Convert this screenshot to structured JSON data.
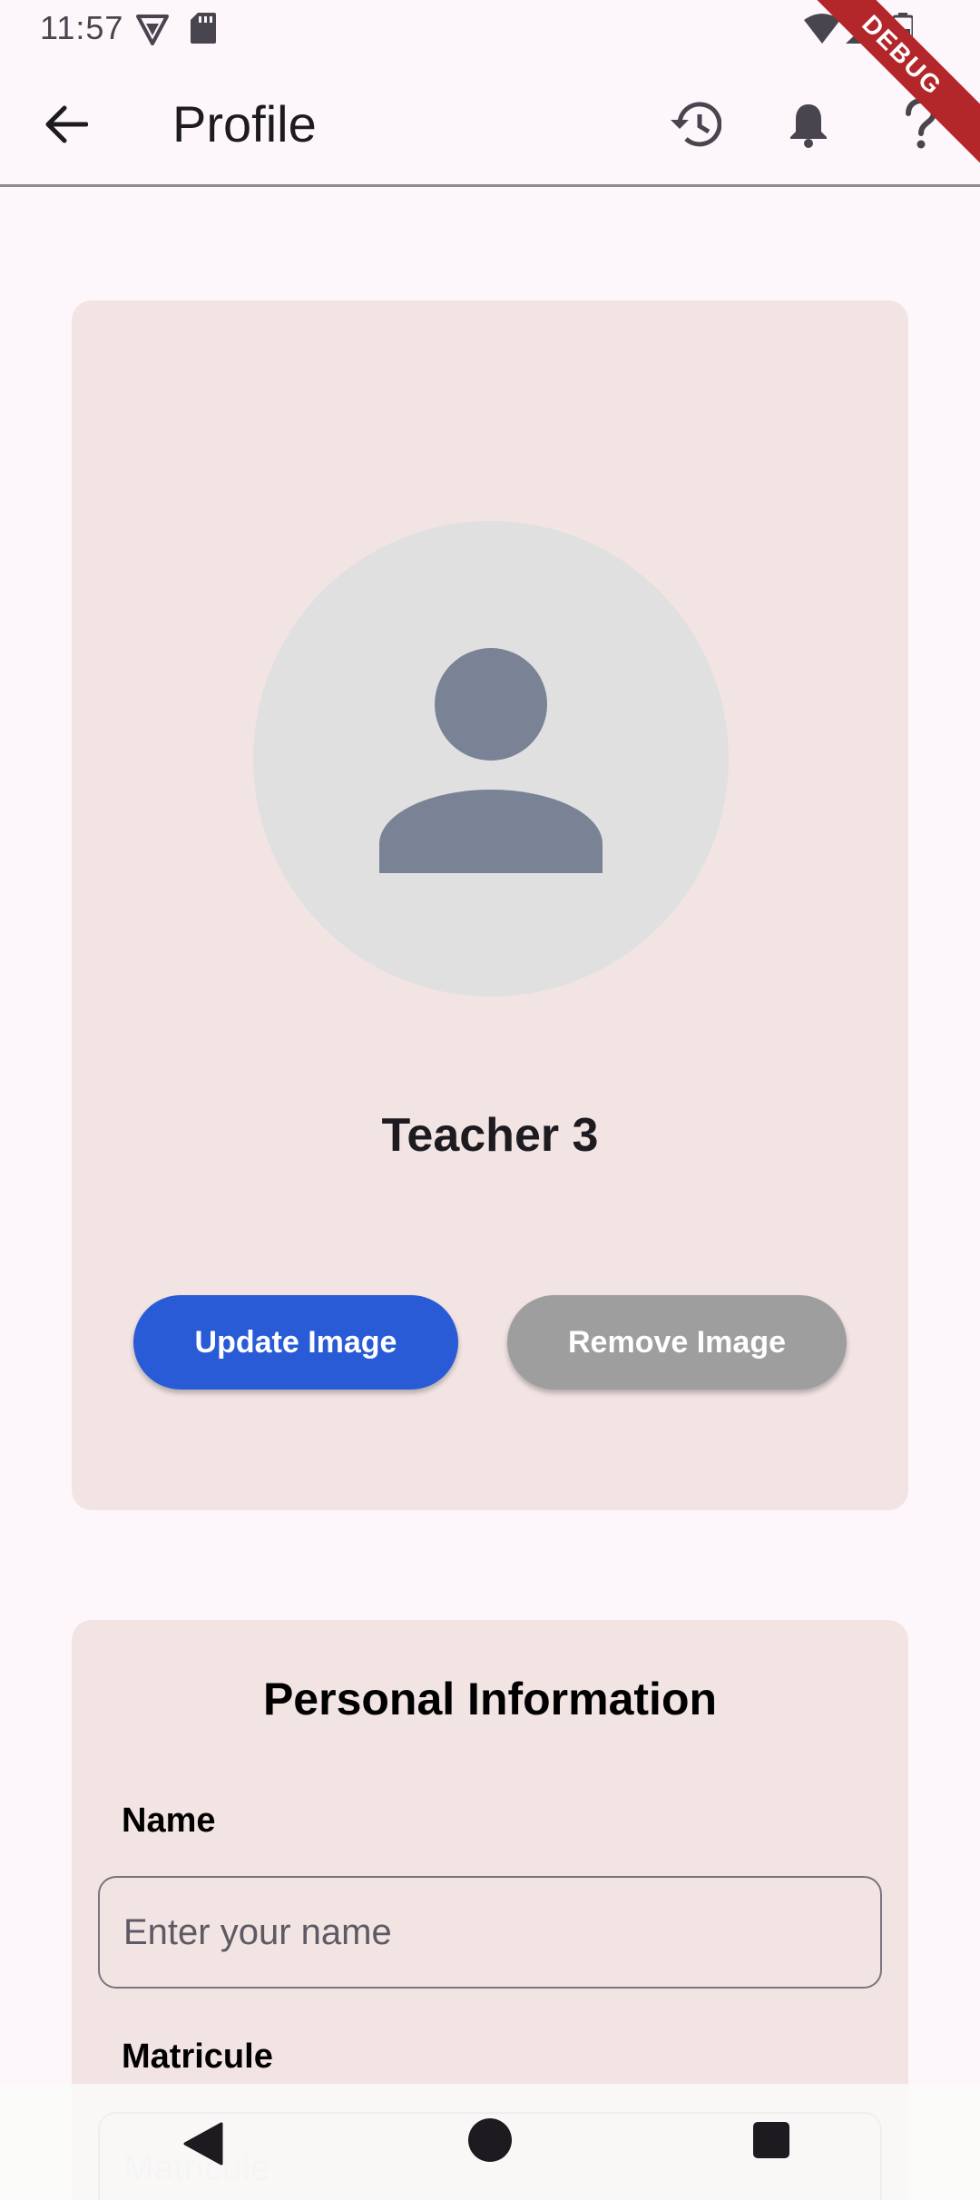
{
  "status_bar": {
    "time": "11:57",
    "icons": [
      "vpn-shield-icon",
      "sd-card-icon",
      "wifi-icon",
      "signal-icon",
      "battery-icon"
    ],
    "debug_banner": "DEBUG"
  },
  "app_bar": {
    "title": "Profile",
    "icons": [
      "arrow-back-icon",
      "history-icon",
      "bell-icon",
      "help-icon"
    ]
  },
  "profile": {
    "name": "Teacher 3",
    "update_image_label": "Update Image",
    "remove_image_label": "Remove Image",
    "avatar_icon": "person-placeholder-icon"
  },
  "personal_info": {
    "title": "Personal Information",
    "name_label": "Name",
    "name_placeholder": "Enter your name",
    "name_value": "",
    "matricule_label": "Matricule",
    "matricule_placeholder": "Matricule",
    "matricule_value": ""
  },
  "nav_bar": {
    "icons": [
      "nav-back-icon",
      "nav-home-icon",
      "nav-recents-icon"
    ]
  },
  "colors": {
    "background": "#FDF7FC",
    "card": "#F2E4E3",
    "primary_button": "#2A5BD7",
    "secondary_button": "#9E9E9E",
    "avatar_bg": "#E0E0E0",
    "avatar_fg": "#7A8296",
    "debug_banner": "#B3262A"
  }
}
